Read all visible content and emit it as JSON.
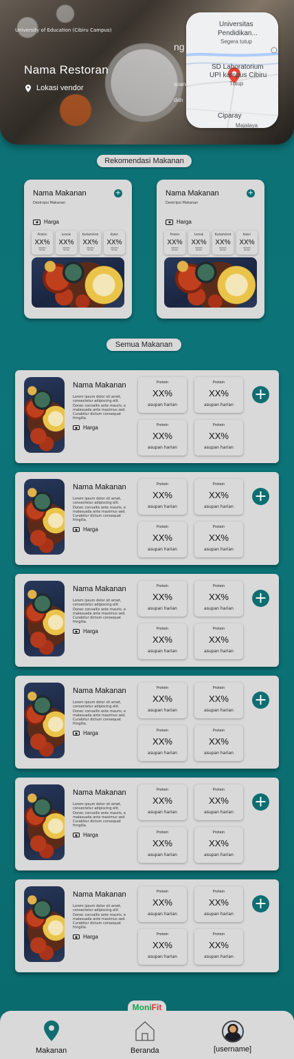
{
  "header": {
    "caption": "University of Education (Cibiru Campus)",
    "restaurant_name": "Nama Restoran",
    "vendor_location": "Lokasi vendor"
  },
  "map": {
    "labels": {
      "university": "Universitas",
      "pendidikan": "Pendidikan...",
      "status_closing": "Segera tutup",
      "sd_lab": "SD Laboratorium",
      "upi": "UPI kampus Cibiru",
      "status_closed": "Tutup",
      "ng": "ng",
      "soang": "soang",
      "dah": "dah",
      "ciparay": "Ciparay",
      "majalaya": "Majalaya"
    }
  },
  "sections": {
    "recommend": "Rekomendasi Makanan",
    "all": "Semua Makanan"
  },
  "recommend_cards": [
    {
      "name": "Nama Makanan",
      "desc": "Deskripsi Makanan",
      "price": "Harga",
      "nutrients": [
        {
          "label": "Protein",
          "value": "XX%",
          "sub": "asupan harian"
        },
        {
          "label": "Lemak",
          "value": "XX%",
          "sub": "asupan harian"
        },
        {
          "label": "Karbohidrat",
          "value": "XX%",
          "sub": "asupan harian"
        },
        {
          "label": "Kalori",
          "value": "XX%",
          "sub": "asupan harian"
        }
      ]
    },
    {
      "name": "Nama Makanan",
      "desc": "Deskripsi Makanan",
      "price": "Harga",
      "nutrients": [
        {
          "label": "Protein",
          "value": "XX%",
          "sub": "asupan harian"
        },
        {
          "label": "Lemak",
          "value": "XX%",
          "sub": "asupan harian"
        },
        {
          "label": "Karbohidrat",
          "value": "XX%",
          "sub": "asupan harian"
        },
        {
          "label": "Kalori",
          "value": "XX%",
          "sub": "asupan harian"
        }
      ]
    }
  ],
  "food_items": [
    {
      "name": "Nama Makanan",
      "desc": "Lorem ipsum dolor sit amet, consectetur adipiscing elit. Donec convallis ante mauris, e malesuada ante maximus sed. Curabitur dictum consequat fringilla.",
      "price": "Harga",
      "nutrients": [
        {
          "label": "Protein",
          "value": "XX%",
          "sub": "asupan harian"
        },
        {
          "label": "Protein",
          "value": "XX%",
          "sub": "asupan harian"
        },
        {
          "label": "Protein",
          "value": "XX%",
          "sub": "asupan harian"
        },
        {
          "label": "Protein",
          "value": "XX%",
          "sub": "asupan harian"
        }
      ]
    },
    {
      "name": "Nama Makanan",
      "desc": "Lorem ipsum dolor sit amet, consectetur adipiscing elit. Donec convallis ante mauris, e malesuada ante maximus sed. Curabitur dictum consequat fringilla.",
      "price": "Harga",
      "nutrients": [
        {
          "label": "Protein",
          "value": "XX%",
          "sub": "asupan harian"
        },
        {
          "label": "Protein",
          "value": "XX%",
          "sub": "asupan harian"
        },
        {
          "label": "Protein",
          "value": "XX%",
          "sub": "asupan harian"
        },
        {
          "label": "Protein",
          "value": "XX%",
          "sub": "asupan harian"
        }
      ]
    },
    {
      "name": "Nama Makanan",
      "desc": "Lorem ipsum dolor sit amet, consectetur adipiscing elit. Donec convallis ante mauris, e malesuada ante maximus sed. Curabitur dictum consequat fringilla.",
      "price": "Harga",
      "nutrients": [
        {
          "label": "Protein",
          "value": "XX%",
          "sub": "asupan harian"
        },
        {
          "label": "Protein",
          "value": "XX%",
          "sub": "asupan harian"
        },
        {
          "label": "Protein",
          "value": "XX%",
          "sub": "asupan harian"
        },
        {
          "label": "Protein",
          "value": "XX%",
          "sub": "asupan harian"
        }
      ]
    },
    {
      "name": "Nama Makanan",
      "desc": "Lorem ipsum dolor sit amet, consectetur adipiscing elit. Donec convallis ante mauris, e malesuada ante maximus sed. Curabitur dictum consequat fringilla.",
      "price": "Harga",
      "nutrients": [
        {
          "label": "Protein",
          "value": "XX%",
          "sub": "asupan harian"
        },
        {
          "label": "Protein",
          "value": "XX%",
          "sub": "asupan harian"
        },
        {
          "label": "Protein",
          "value": "XX%",
          "sub": "asupan harian"
        },
        {
          "label": "Protein",
          "value": "XX%",
          "sub": "asupan harian"
        }
      ]
    },
    {
      "name": "Nama Makanan",
      "desc": "Lorem ipsum dolor sit amet, consectetur adipiscing elit. Donec convallis ante mauris, e malesuada ante maximus sed. Curabitur dictum consequat fringilla.",
      "price": "Harga",
      "nutrients": [
        {
          "label": "Protein",
          "value": "XX%",
          "sub": "asupan harian"
        },
        {
          "label": "Protein",
          "value": "XX%",
          "sub": "asupan harian"
        },
        {
          "label": "Protein",
          "value": "XX%",
          "sub": "asupan harian"
        },
        {
          "label": "Protein",
          "value": "XX%",
          "sub": "asupan harian"
        }
      ]
    },
    {
      "name": "Nama Makanan",
      "desc": "Lorem ipsum dolor sit amet, consectetur adipiscing elit. Donec convallis ante mauris, e malesuada ante maximus sed. Curabitur dictum consequat fringilla.",
      "price": "Harga",
      "nutrients": [
        {
          "label": "Protein",
          "value": "XX%",
          "sub": "asupan harian"
        },
        {
          "label": "Protein",
          "value": "XX%",
          "sub": "asupan harian"
        },
        {
          "label": "Protein",
          "value": "XX%",
          "sub": "asupan harian"
        },
        {
          "label": "Protein",
          "value": "XX%",
          "sub": "asupan harian"
        }
      ]
    }
  ],
  "brand": {
    "part1": "Moni",
    "part2": "Fit"
  },
  "nav": {
    "makanan": "Makanan",
    "beranda": "Beranda",
    "user": "[username]"
  },
  "icons": {
    "add": "plus-icon",
    "price": "cash-icon",
    "location": "map-pin-icon",
    "home": "home-icon"
  },
  "colors": {
    "accent": "#0f6e72",
    "card": "#d9d9d9",
    "brand_green": "#17a34a",
    "brand_red": "#e23030"
  }
}
